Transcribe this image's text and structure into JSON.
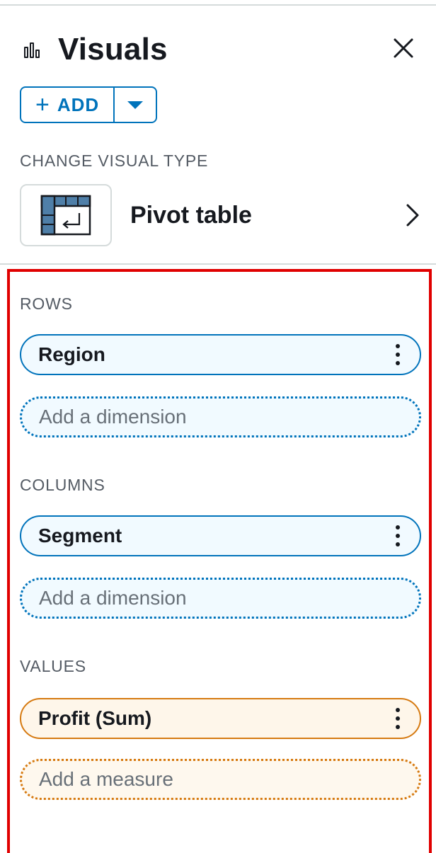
{
  "panel": {
    "title": "Visuals",
    "title_icon": "bar-chart-icon",
    "close_icon": "close-icon"
  },
  "add_button": {
    "plus": "+",
    "label": "ADD",
    "dropdown_icon": "caret-down-icon"
  },
  "visual_type": {
    "section_label": "CHANGE VISUAL TYPE",
    "name": "Pivot table",
    "icon": "pivot-table-icon",
    "chevron_icon": "chevron-right-icon"
  },
  "field_wells": {
    "rows": {
      "label": "ROWS",
      "field": "Region",
      "placeholder": "Add a dimension"
    },
    "columns": {
      "label": "COLUMNS",
      "field": "Segment",
      "placeholder": "Add a dimension"
    },
    "values": {
      "label": "VALUES",
      "field": "Profit (Sum)",
      "placeholder": "Add a measure"
    }
  },
  "colors": {
    "accent": "#0073bb",
    "dimension_fill": "#f1faff",
    "measure_border": "#d67a11",
    "measure_fill": "#fef6ea",
    "highlight": "#e00000"
  }
}
